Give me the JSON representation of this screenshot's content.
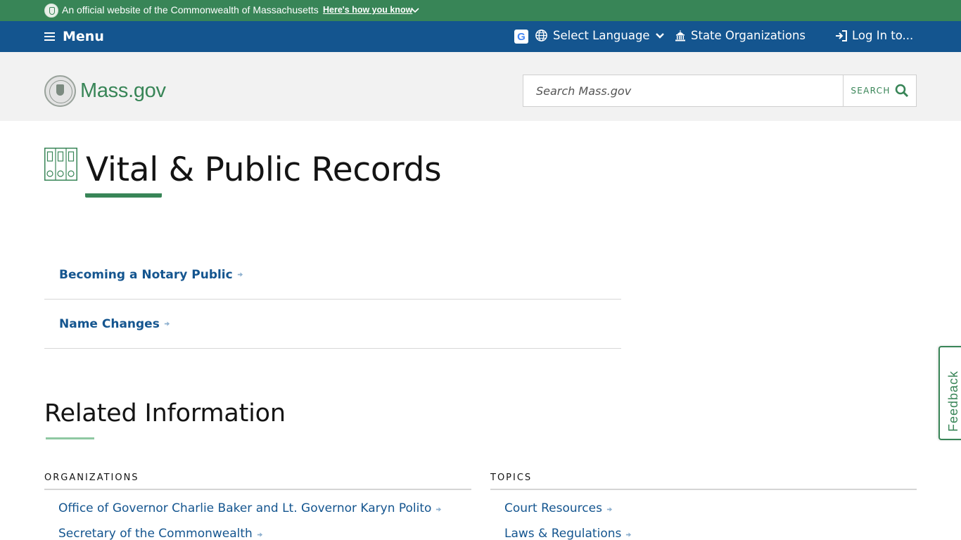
{
  "official_banner": {
    "text": "An official website of the Commonwealth of Massachusetts",
    "how_link": "Here's how you know",
    "icons": [
      "seal-icon",
      "chevron-down-icon"
    ]
  },
  "utility_nav": {
    "menu_label": "Menu",
    "translate_icon_letter": "G",
    "language_label": "Select Language",
    "state_orgs_label": "State Organizations",
    "login_label": "Log In to...",
    "icons": [
      "hamburger-icon",
      "google-translate-icon",
      "globe-icon",
      "chevron-down-icon",
      "capitol-icon",
      "login-icon"
    ]
  },
  "header": {
    "logo_text": "Mass.gov",
    "search_placeholder": "Search Mass.gov",
    "search_value": "",
    "search_button_label": "SEARCH",
    "icons": [
      "mass-seal-icon",
      "search-icon"
    ]
  },
  "page": {
    "title": "Vital & Public Records",
    "title_icon": "binders-icon",
    "links": [
      {
        "label": "Becoming a Notary Public"
      },
      {
        "label": "Name Changes"
      }
    ]
  },
  "related": {
    "title": "Related Information",
    "organizations": {
      "heading": "ORGANIZATIONS",
      "items": [
        {
          "label": "Office of Governor Charlie Baker and Lt. Governor Karyn Polito"
        },
        {
          "label": "Secretary of the Commonwealth"
        }
      ]
    },
    "topics": {
      "heading": "TOPICS",
      "items": [
        {
          "label": "Court Resources"
        },
        {
          "label": "Laws & Regulations"
        }
      ]
    }
  },
  "feedback": {
    "label": "Feedback"
  },
  "colors": {
    "official_green": "#388557",
    "nav_blue": "#14558f",
    "header_gray": "#f2f2f2",
    "link_blue": "#14558f",
    "title_underline": "#388557",
    "related_underline": "#8fc8a2"
  }
}
